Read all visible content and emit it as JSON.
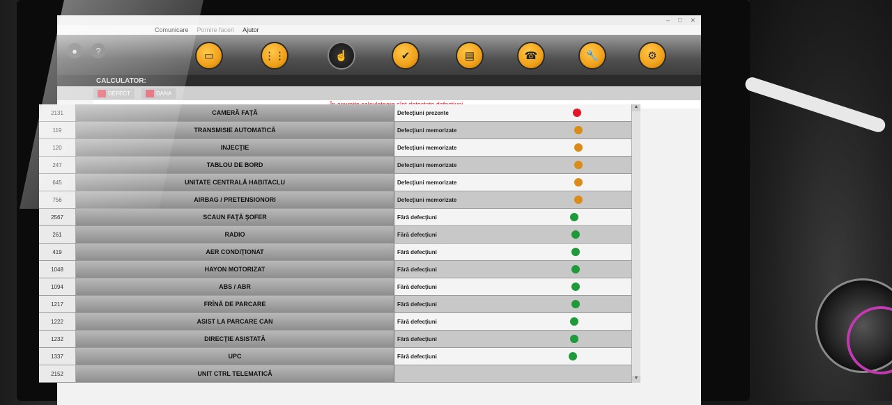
{
  "window": {
    "title": "",
    "controls": [
      "–",
      "□",
      "✕"
    ]
  },
  "menu": [
    {
      "label": "Comunicare",
      "disabled": false
    },
    {
      "label": "Pornire faceri",
      "disabled": true
    },
    {
      "label": "Ajutor",
      "disabled": false
    }
  ],
  "toolbar": {
    "buttons": [
      {
        "icon": "vehicle-id-icon",
        "glyph": "▭"
      },
      {
        "icon": "gearbox-icon",
        "glyph": "⋮⋮"
      },
      {
        "icon": "touch-icon",
        "glyph": "☝"
      },
      {
        "icon": "checklist-icon",
        "glyph": "✔"
      },
      {
        "icon": "ecu-icon",
        "glyph": "▤"
      },
      {
        "icon": "phone-support-icon",
        "glyph": "☎"
      },
      {
        "icon": "wrench-icon",
        "glyph": "🔧"
      },
      {
        "icon": "car-repair-icon",
        "glyph": "⚙"
      }
    ],
    "left_icons": [
      "logo-icon",
      "help-icon"
    ]
  },
  "calculator_label": "CALCULATOR:",
  "filters": [
    {
      "label": "DEFECT"
    },
    {
      "label": "DANA"
    }
  ],
  "alert_text": "În anumite calculatoare sînt detectate defecţiuni",
  "status_colors": {
    "red": "#e2172b",
    "orange": "#d98c1a",
    "green": "#1f9a3a"
  },
  "rows": [
    {
      "id": "2131",
      "name": "CAMERĂ FAŢĂ",
      "status": "Defecţiuni prezente",
      "color": "red"
    },
    {
      "id": "119",
      "name": "TRANSMISIE AUTOMATICĂ",
      "status": "Defecţiuni memorizate",
      "color": "orange"
    },
    {
      "id": "120",
      "name": "INJECŢIE",
      "status": "Defecţiuni memorizate",
      "color": "orange"
    },
    {
      "id": "247",
      "name": "TABLOU DE BORD",
      "status": "Defecţiuni memorizate",
      "color": "orange"
    },
    {
      "id": "645",
      "name": "UNITATE CENTRALĂ HABITACLU",
      "status": "Defecţiuni memorizate",
      "color": "orange"
    },
    {
      "id": "756",
      "name": "AIRBAG / PRETENSIONORI",
      "status": "Defecţiuni memorizate",
      "color": "orange"
    },
    {
      "id": "2567",
      "name": "SCAUN FAŢĂ ŞOFER",
      "status": "Fără defecţiuni",
      "color": "green"
    },
    {
      "id": "261",
      "name": "RADIO",
      "status": "Fără defecţiuni",
      "color": "green"
    },
    {
      "id": "419",
      "name": "AER CONDIŢIONAT",
      "status": "Fără defecţiuni",
      "color": "green"
    },
    {
      "id": "1048",
      "name": "HAYON MOTORIZAT",
      "status": "Fără defecţiuni",
      "color": "green"
    },
    {
      "id": "1094",
      "name": "ABS / ABR",
      "status": "Fără defecţiuni",
      "color": "green"
    },
    {
      "id": "1217",
      "name": "FRÎNĂ DE PARCARE",
      "status": "Fără defecţiuni",
      "color": "green"
    },
    {
      "id": "1222",
      "name": "ASIST LA PARCARE CAN",
      "status": "Fără defecţiuni",
      "color": "green"
    },
    {
      "id": "1232",
      "name": "DIRECŢIE ASISTATĂ",
      "status": "Fără defecţiuni",
      "color": "green"
    },
    {
      "id": "1337",
      "name": "UPC",
      "status": "Fără defecţiuni",
      "color": "green"
    },
    {
      "id": "2152",
      "name": "UNIT CTRL TELEMATICĂ",
      "status": "",
      "color": ""
    }
  ]
}
